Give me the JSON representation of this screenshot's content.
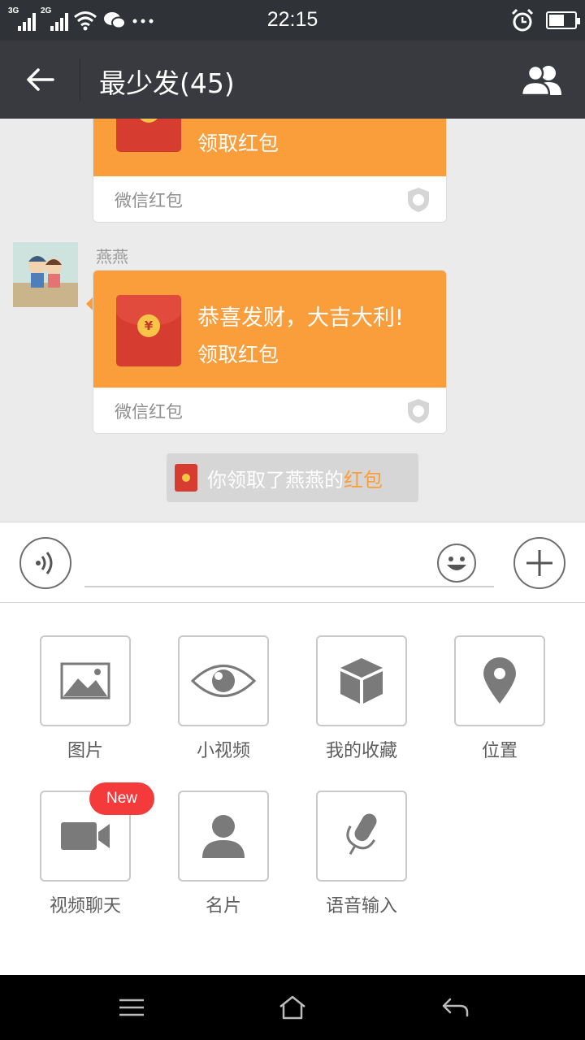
{
  "status_bar": {
    "time": "22:15",
    "net1": "3G",
    "net2": "2G",
    "battery_level": 0.6
  },
  "header": {
    "title": "最少发(45)"
  },
  "messages": {
    "partial_packet": {
      "action": "领取红包",
      "brand": "微信红包"
    },
    "sender_name": "燕燕",
    "red_packet": {
      "greeting": "恭喜发财，大吉大利!",
      "action": "领取红包",
      "brand": "微信红包"
    },
    "system": {
      "text_prefix": "你领取了燕燕的",
      "text_highlight": "红包"
    }
  },
  "input": {
    "placeholder": ""
  },
  "tools": [
    {
      "label": "图片",
      "icon": "image-icon"
    },
    {
      "label": "小视频",
      "icon": "eye-icon"
    },
    {
      "label": "我的收藏",
      "icon": "cube-icon"
    },
    {
      "label": "位置",
      "icon": "location-pin-icon"
    },
    {
      "label": "视频聊天",
      "icon": "video-camera-icon",
      "badge": "New"
    },
    {
      "label": "名片",
      "icon": "person-icon"
    },
    {
      "label": "语音输入",
      "icon": "microphone-icon"
    }
  ],
  "colors": {
    "header_bg": "#393a3f",
    "red_packet_orange": "#fa9d3b",
    "badge_red": "#f43a3a"
  }
}
